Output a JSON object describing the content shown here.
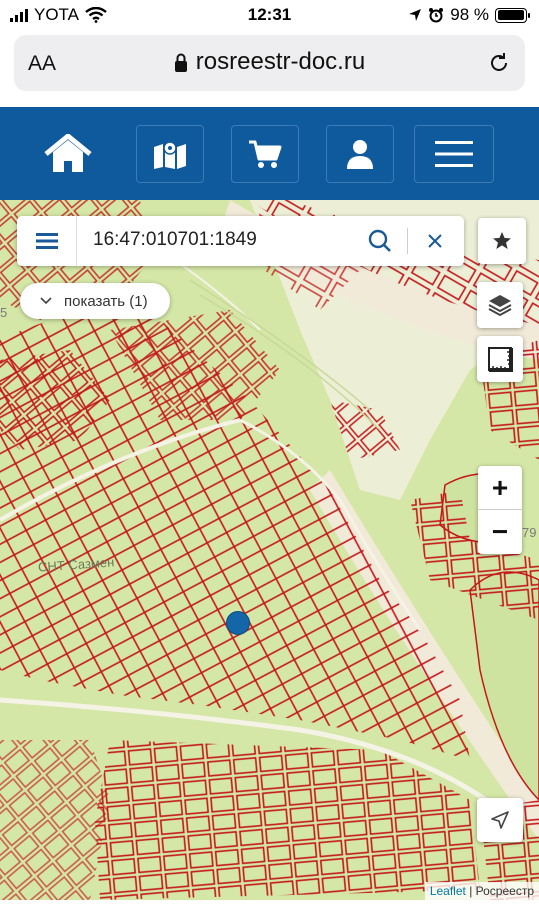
{
  "status_bar": {
    "carrier": "YOTA",
    "time": "12:31",
    "battery_percent": "98 %",
    "battery_level": 0.98
  },
  "browser": {
    "text_size_label": "AA",
    "url": "rosreestr-doc.ru"
  },
  "navbar": {
    "items": [
      {
        "icon": "home-icon"
      },
      {
        "icon": "map-icon"
      },
      {
        "icon": "cart-icon"
      },
      {
        "icon": "user-icon"
      },
      {
        "icon": "menu-icon"
      }
    ]
  },
  "search": {
    "value": "16:47:010701:1849"
  },
  "show_button": {
    "label": "показать (1)"
  },
  "map": {
    "label_snt": "СНТ Сазмен",
    "label_right": "79",
    "label_left": "5",
    "zoom_in": "+",
    "zoom_out": "−",
    "attribution_link": "Leaflet",
    "attribution_text": " | Росреестр",
    "colors": {
      "land": "#d4e7a6",
      "parcel_stroke": "#c4171c",
      "road": "#f1ead8",
      "navbar": "#0f5a9c"
    }
  }
}
